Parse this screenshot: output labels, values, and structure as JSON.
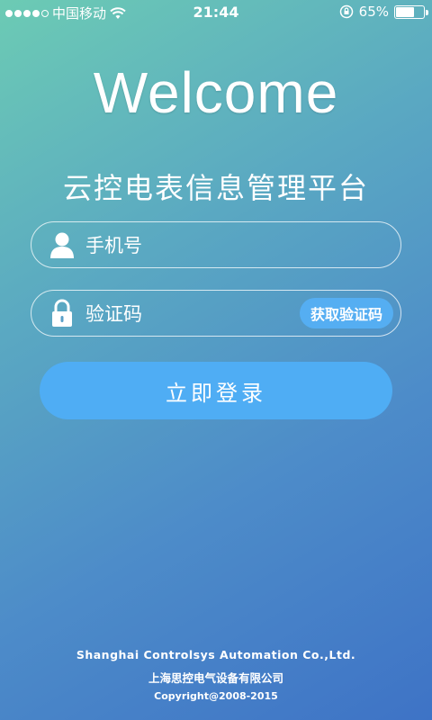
{
  "status_bar": {
    "carrier": "中国移动",
    "time": "21:44",
    "battery_percent": "65%",
    "battery_level": 0.65
  },
  "welcome": "Welcome",
  "subtitle": "云控电表信息管理平台",
  "phone_field": {
    "placeholder": "手机号",
    "icon": "user-icon"
  },
  "code_field": {
    "placeholder": "验证码",
    "icon": "lock-icon",
    "get_code_label": "获取验证码"
  },
  "login_label": "立即登录",
  "footer": {
    "company_en": "Shanghai Controlsys Automation Co.,Ltd.",
    "company_cn": "上海思控电气设备有限公司",
    "copyright": "Copyright@2008-2015"
  },
  "colors": {
    "button": "#4fadf4",
    "get_code_button": "#55aef2"
  }
}
